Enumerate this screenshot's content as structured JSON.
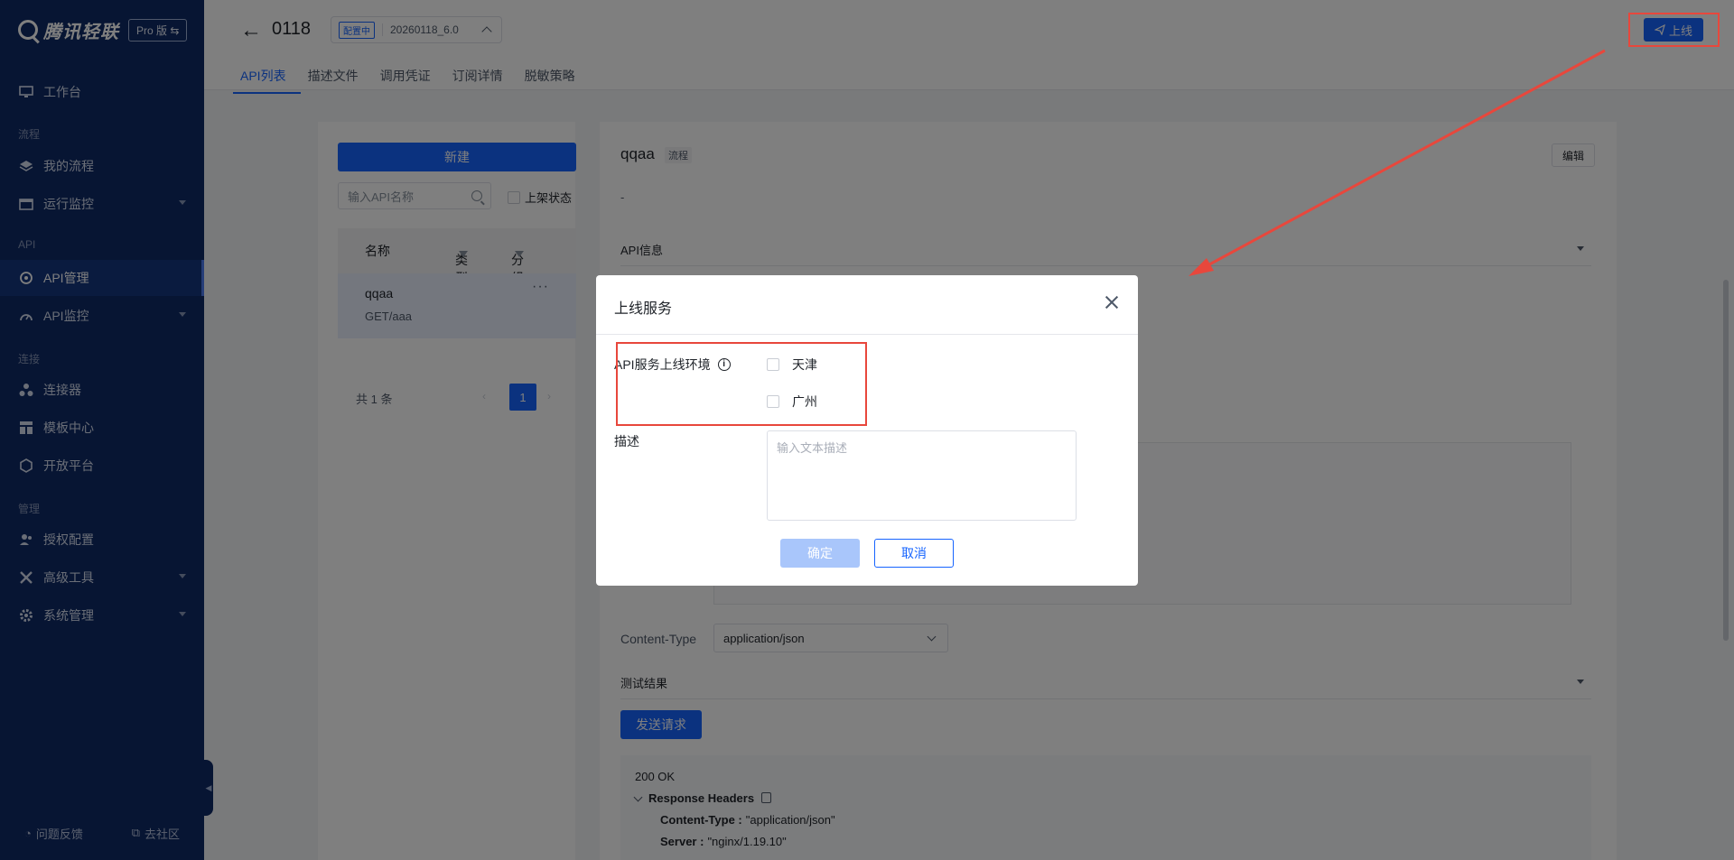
{
  "app": {
    "logo_text": "腾讯轻联",
    "pro_badge": "Pro 版 ⇆"
  },
  "sidebar": {
    "items": [
      {
        "label": "工作台",
        "section": ""
      },
      {
        "label": "我的流程",
        "section": "流程"
      },
      {
        "label": "运行监控",
        "section": ""
      },
      {
        "label": "API管理",
        "section": "API"
      },
      {
        "label": "API监控",
        "section": ""
      },
      {
        "label": "连接器",
        "section": "连接"
      },
      {
        "label": "模板中心",
        "section": ""
      },
      {
        "label": "开放平台",
        "section": ""
      },
      {
        "label": "授权配置",
        "section": "管理"
      },
      {
        "label": "高级工具",
        "section": ""
      },
      {
        "label": "系统管理",
        "section": ""
      }
    ],
    "sections": {
      "flow": "流程",
      "api": "API",
      "connect": "连接",
      "manage": "管理"
    },
    "footer": {
      "feedback": "问题反馈",
      "community": "去社区"
    }
  },
  "header": {
    "title": "0118",
    "version_status": "配置中",
    "version": "20260118_6.0",
    "tabs": [
      "API列表",
      "描述文件",
      "调用凭证",
      "订阅详情",
      "脱敏策略"
    ],
    "online_button": "上线"
  },
  "left_panel": {
    "new_button": "新建",
    "search_placeholder": "输入API名称",
    "shelf_status": "上架状态",
    "columns": {
      "name": "名称",
      "type": "类型",
      "group": "分组"
    },
    "row": {
      "name": "qqaa",
      "path": "GET/aaa",
      "more": "···"
    },
    "pager": {
      "total": "共 1 条",
      "page": "1"
    }
  },
  "right_panel": {
    "title": "qqaa",
    "tag": "流程",
    "edit": "编辑",
    "desc": "-",
    "api_info": "API信息",
    "content_type_label": "Content-Type",
    "content_type": "application/json",
    "test_result": "测试结果",
    "send_button": "发送请求",
    "response": {
      "status": "200 OK",
      "headers_title": "Response Headers",
      "headers": [
        {
          "key": "Content-Type",
          "value": "\"application/json\""
        },
        {
          "key": "Server",
          "value": "\"nginx/1.19.10\""
        }
      ]
    }
  },
  "modal": {
    "title": "上线服务",
    "env_label": "API服务上线环境",
    "envs": [
      "天津",
      "广州"
    ],
    "desc_label": "描述",
    "desc_placeholder": "输入文本描述",
    "confirm": "确定",
    "cancel": "取消"
  },
  "colors": {
    "primary": "#1664ff",
    "sidebar": "#0f2a66",
    "annotation": "#e8473c"
  }
}
